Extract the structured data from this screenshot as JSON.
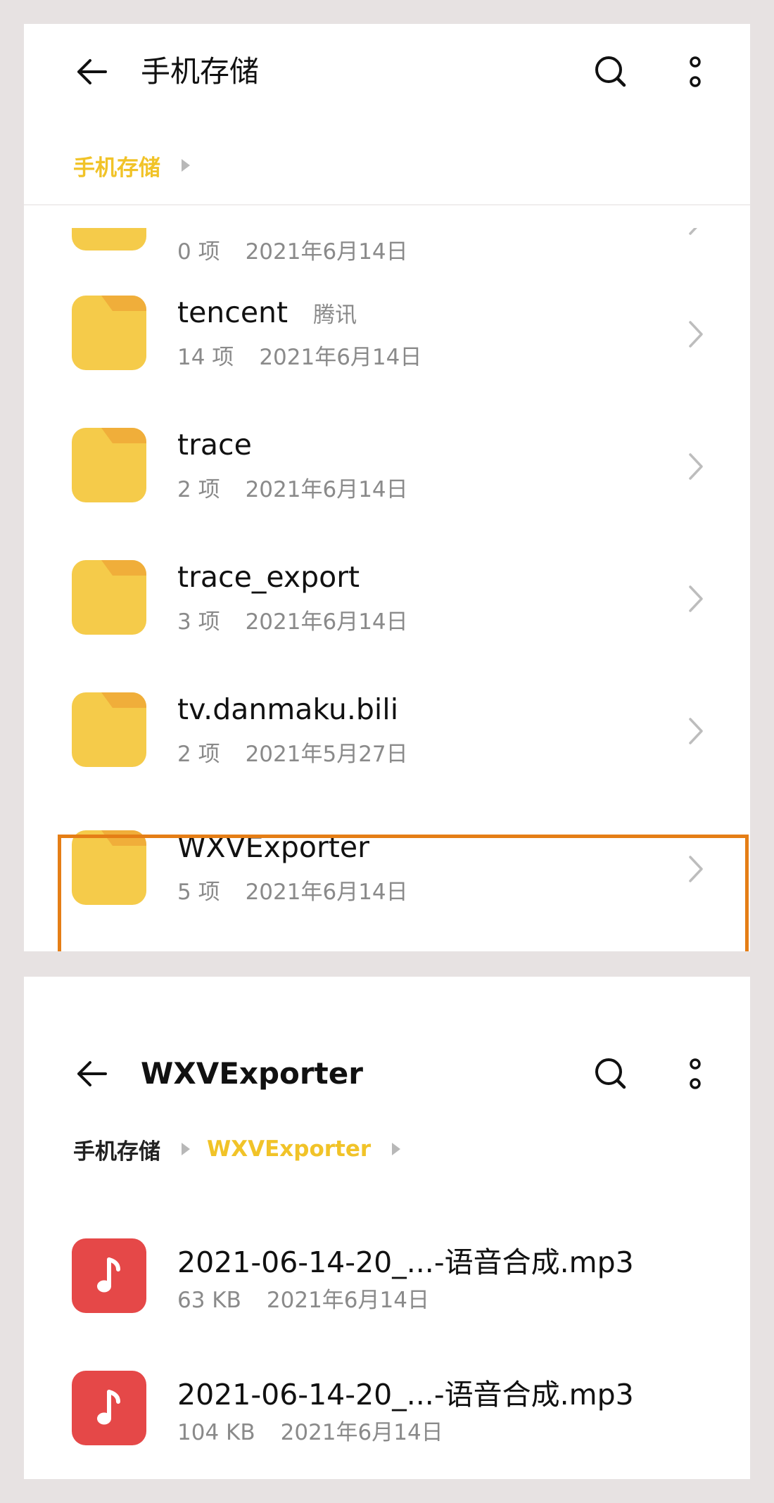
{
  "top": {
    "title": "手机存储",
    "breadcrumb": [
      "手机存储"
    ],
    "partial_item": {
      "count": "0 项",
      "date": "2021年6月14日"
    },
    "folders": [
      {
        "name": "tencent",
        "alias": "腾讯",
        "count": "14 项",
        "date": "2021年6月14日"
      },
      {
        "name": "trace",
        "alias": "",
        "count": "2 项",
        "date": "2021年6月14日"
      },
      {
        "name": "trace_export",
        "alias": "",
        "count": "3 项",
        "date": "2021年6月14日"
      },
      {
        "name": "tv.danmaku.bili",
        "alias": "",
        "count": "2 项",
        "date": "2021年5月27日"
      },
      {
        "name": "WXVExporter",
        "alias": "",
        "count": "5 项",
        "date": "2021年6月14日"
      }
    ]
  },
  "bottom": {
    "title": "WXVExporter",
    "breadcrumb": [
      "手机存储",
      "WXVExporter"
    ],
    "files": [
      {
        "name": "2021-06-14-20_...-语音合成.mp3",
        "size": "63 KB",
        "date": "2021年6月14日"
      },
      {
        "name": "2021-06-14-20_...-语音合成.mp3",
        "size": "104 KB",
        "date": "2021年6月14日"
      }
    ]
  },
  "icons": {
    "back": "back-arrow-icon",
    "search": "search-icon",
    "more": "more-vertical-icon",
    "folder": "folder-icon",
    "audio": "music-note-icon",
    "chevron": "chevron-right-icon",
    "crumb_arrow": "breadcrumb-triangle-icon"
  },
  "colors": {
    "accent": "#f1c328",
    "folder": "#f5cb4a",
    "folder_tab": "#f0ae3a",
    "audio_tile": "#e54848",
    "highlight": "#e57e16",
    "secondary_text": "#8a8a8a"
  }
}
